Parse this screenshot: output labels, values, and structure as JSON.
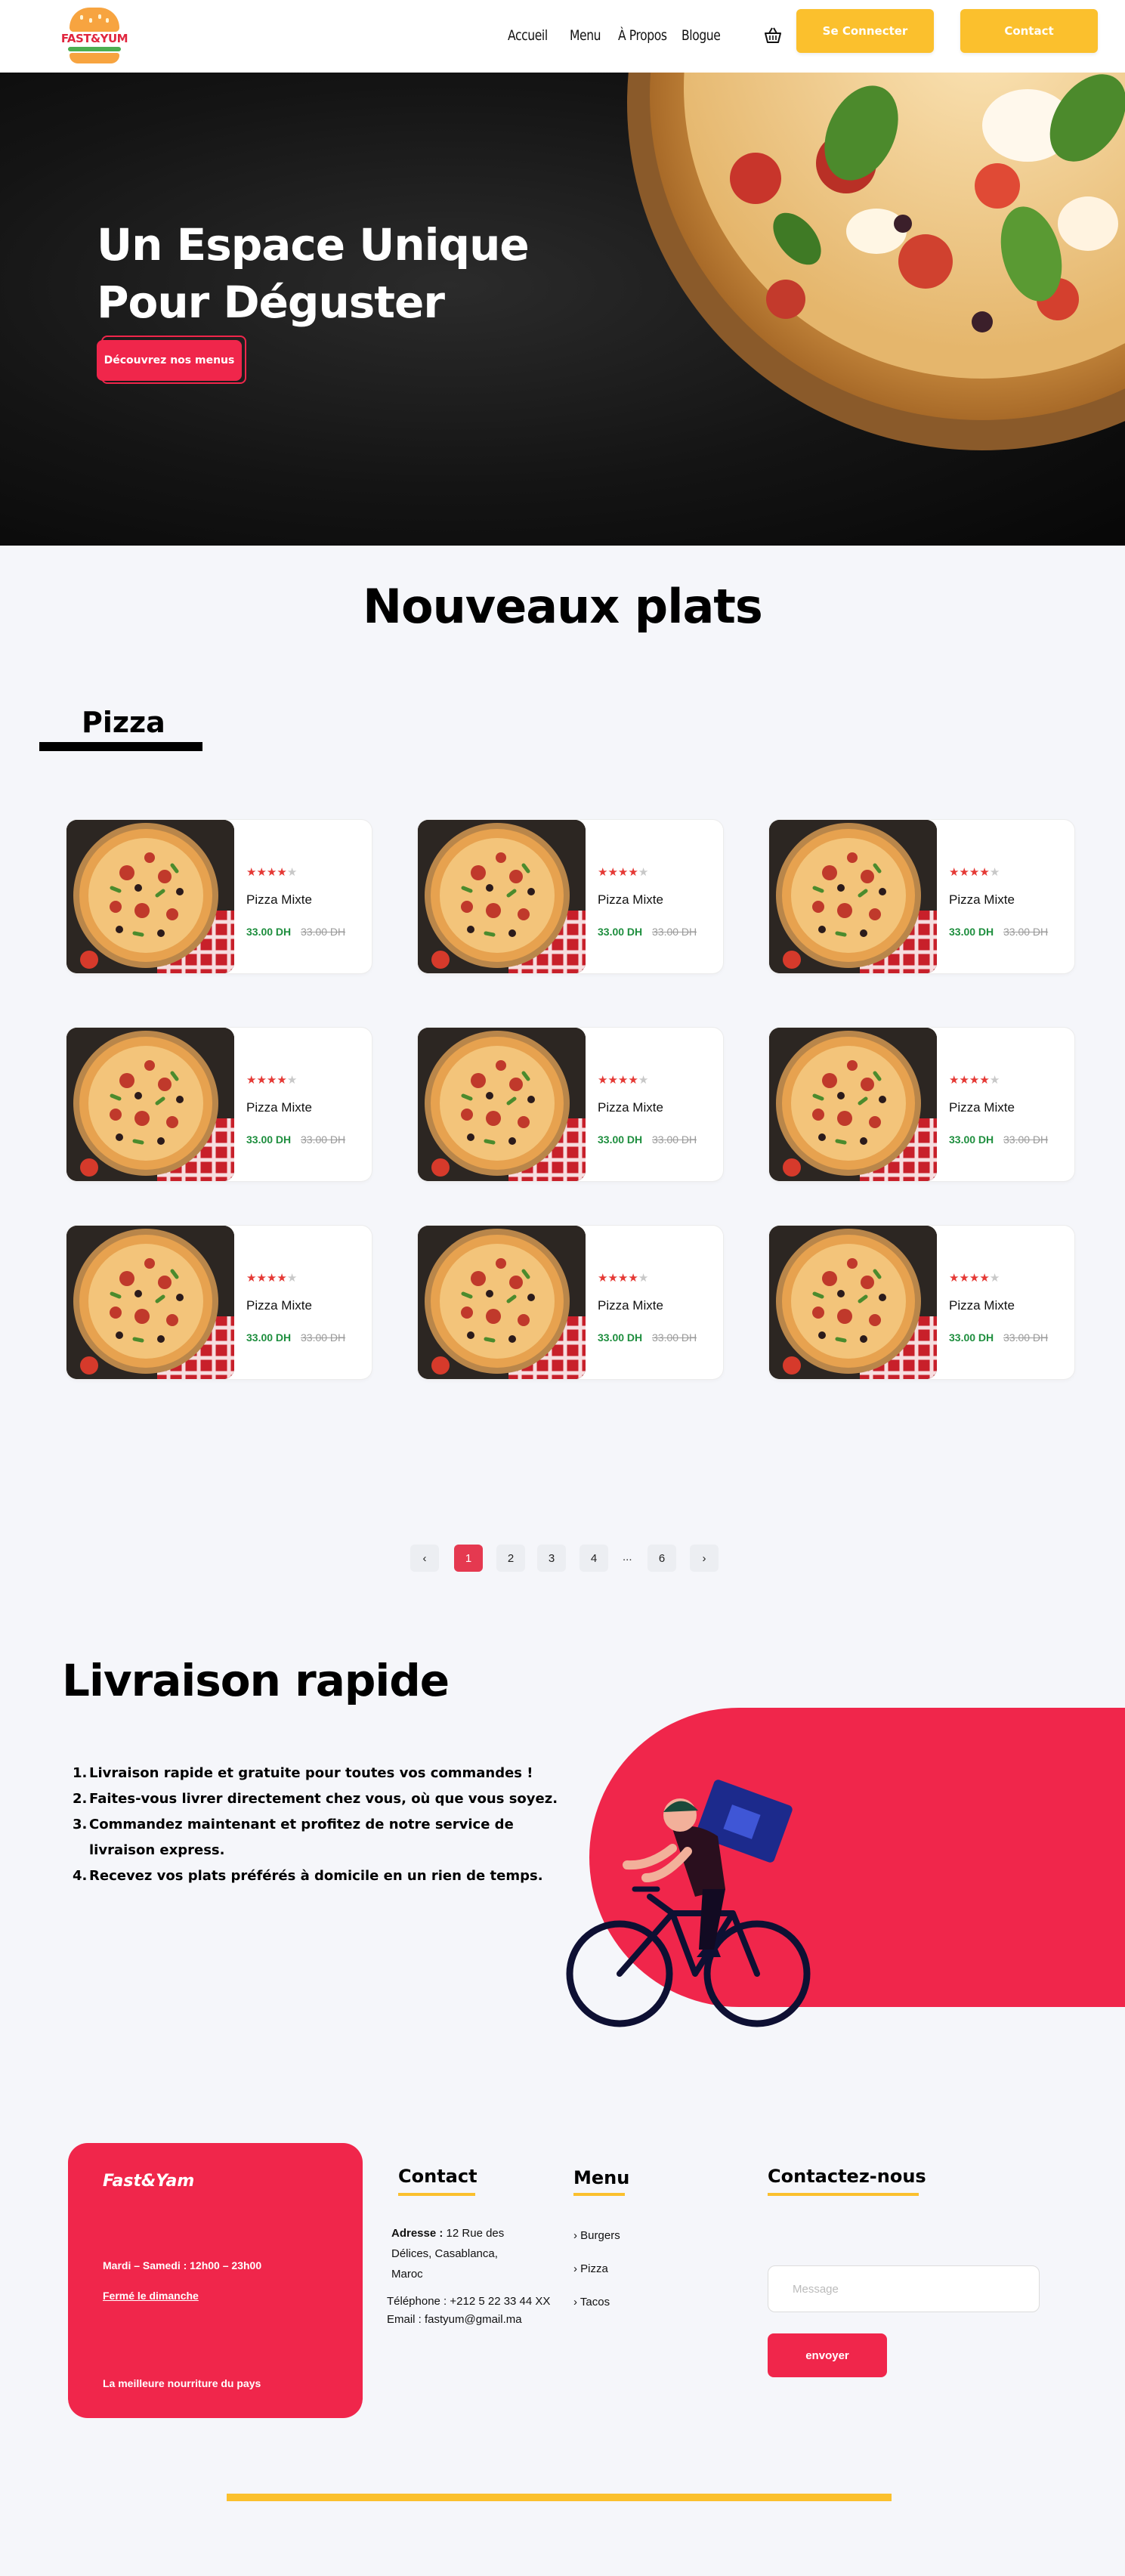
{
  "brand": {
    "logo_text": "FAST&YUM"
  },
  "nav": {
    "links": [
      "Accueil",
      "Menu",
      "À Propos",
      "Blogue"
    ],
    "cart_icon": "shopping-basket-icon",
    "login_label": "Se Connecter",
    "contact_label": "Contact"
  },
  "hero": {
    "title_line1": "Un Espace Unique",
    "title_line2": "Pour Déguster",
    "cta_label": "Découvrez nos menus"
  },
  "menu_section": {
    "title": "Nouveaux plats",
    "category": "Pizza",
    "items": [
      {
        "name": "Pizza Mixte",
        "price": "33.00 DH",
        "old_price": "33.00 DH",
        "rating": 4
      },
      {
        "name": "Pizza Mixte",
        "price": "33.00 DH",
        "old_price": "33.00 DH",
        "rating": 4
      },
      {
        "name": "Pizza Mixte",
        "price": "33.00 DH",
        "old_price": "33.00 DH",
        "rating": 4
      },
      {
        "name": "Pizza Mixte",
        "price": "33.00 DH",
        "old_price": "33.00 DH",
        "rating": 4
      },
      {
        "name": "Pizza Mixte",
        "price": "33.00 DH",
        "old_price": "33.00 DH",
        "rating": 4
      },
      {
        "name": "Pizza Mixte",
        "price": "33.00 DH",
        "old_price": "33.00 DH",
        "rating": 4
      },
      {
        "name": "Pizza Mixte",
        "price": "33.00 DH",
        "old_price": "33.00 DH",
        "rating": 4
      },
      {
        "name": "Pizza Mixte",
        "price": "33.00 DH",
        "old_price": "33.00 DH",
        "rating": 4
      },
      {
        "name": "Pizza Mixte",
        "price": "33.00 DH",
        "old_price": "33.00 DH",
        "rating": 4
      }
    ]
  },
  "pagination": {
    "prev": "‹",
    "pages": [
      "1",
      "2",
      "3",
      "4"
    ],
    "ellipsis": "...",
    "last": "6",
    "next": "›",
    "current": "1"
  },
  "delivery": {
    "title": "Livraison rapide",
    "items": [
      "Livraison rapide et gratuite pour toutes vos commandes !",
      "Faites-vous livrer directement chez vous, où que vous soyez.",
      "Commandez maintenant et profitez de notre service de livraison express.",
      "Recevez vos plats préférés à domicile en un rien de temps."
    ]
  },
  "footer": {
    "brand": "Fast&Yam",
    "hours": "Mardi – Samedi : 12h00 – 23h00",
    "closed": "Fermé le dimanche",
    "tagline": "La meilleure nourriture du pays",
    "contact": {
      "heading": "Contact",
      "address_label": "Adresse :",
      "address_line1": "12 Rue des",
      "address_line2": "Délices, Casablanca,",
      "address_line3": "Maroc",
      "phone": "Téléphone : +212 5 22 33 44 XX",
      "email": "Email : fastyum@gmail.ma"
    },
    "menu": {
      "heading": "Menu",
      "links": [
        "Burgers",
        "Pizza",
        "Tacos"
      ]
    },
    "form": {
      "heading": "Contactez-nous",
      "placeholder": "Message",
      "button": "envoyer"
    }
  },
  "colors": {
    "accent_red": "#f0264b",
    "accent_yellow": "#fbc02d",
    "price_green": "#1e8e3e"
  }
}
